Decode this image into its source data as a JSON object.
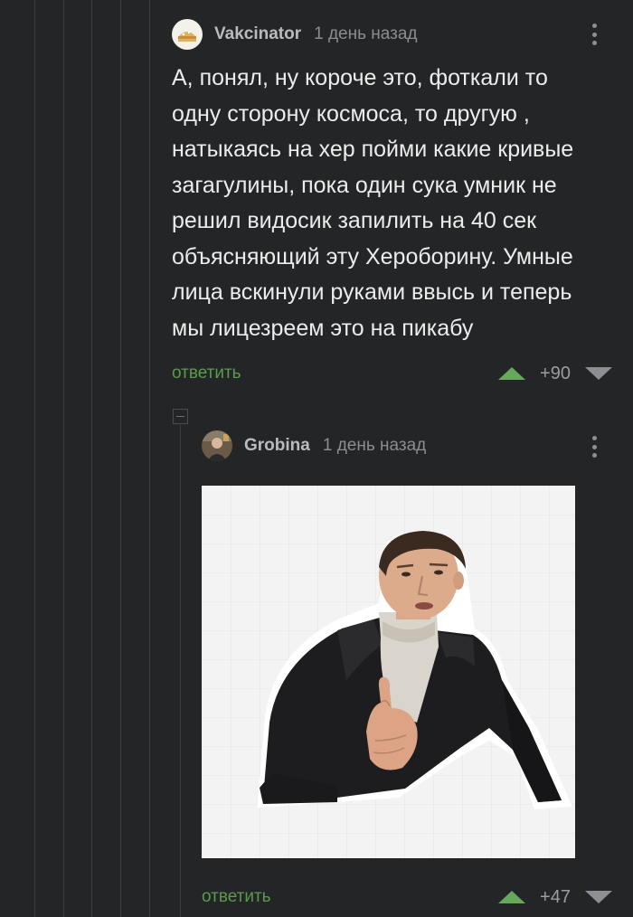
{
  "comments": [
    {
      "username": "Vakcinator",
      "timestamp": "1 день назад",
      "text_lines": [
        "А, понял, ну короче это, фоткали то",
        "одну сторону космоса, то другую ,",
        "натыкаясь на хер пойми какие кривые",
        "загагулины, пока один сука умник не",
        "решил видосик запилить на 40 сек",
        "объясняющий эту Хероборину. Умные",
        "лица вскинули руками ввысь и теперь",
        "мы лицезреем это на пикабу"
      ],
      "reply_label": "ответить",
      "rating": "+90",
      "avatar_icon": "avatar-sandwich-icon"
    },
    {
      "username": "Grobina",
      "timestamp": "1 день назад",
      "image_icon": "man-pointing-sticker-image",
      "reply_label": "ответить",
      "rating": "+47",
      "avatar_icon": "avatar-photo-icon"
    }
  ],
  "colors": {
    "background": "#232527",
    "accent_green": "#5c9a4c",
    "upvote_green": "#68a85a",
    "thread_line": "#3a3d40"
  }
}
